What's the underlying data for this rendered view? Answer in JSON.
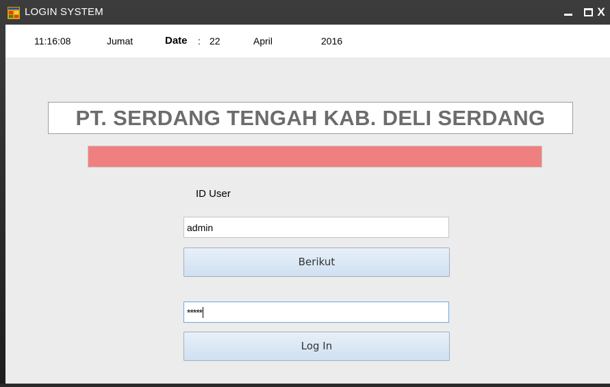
{
  "window": {
    "title": "LOGIN SYSTEM",
    "icon": "app-window-icon",
    "controls": {
      "minimize": "minimize-icon",
      "maximize": "maximize-icon",
      "close": "X"
    }
  },
  "infobar": {
    "time": "11:16:08",
    "day": "Jumat",
    "date_label": "Date",
    "date_sep": ":",
    "date_day": "22",
    "month": "April",
    "year": "2016"
  },
  "company_name": "PT. SERDANG TENGAH KAB. DELI SERDANG",
  "status_bar_color": "#F08080",
  "login": {
    "user_label": "ID User",
    "user_value": "admin",
    "next_button": "Berikut",
    "password_masked": "*****",
    "login_button": "Log In"
  }
}
